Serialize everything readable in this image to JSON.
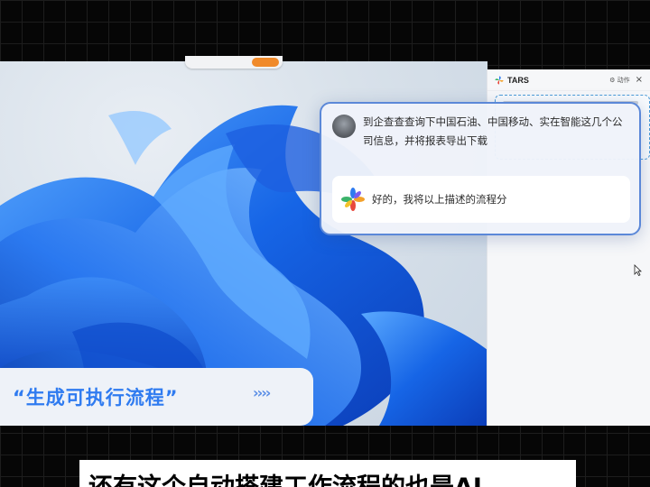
{
  "tars_panel": {
    "title": "TARS",
    "action_label": "动作",
    "close_label": "×"
  },
  "chat": {
    "user_message": "到企查查查询下中国石油、中国移动、实在智能这几个公司信息，并将报表导出下载",
    "bot_message": "好的，我将以上描述的流程分"
  },
  "caption": {
    "text": "“生成可执行流程”",
    "arrows": "››››"
  },
  "subtitle": {
    "text": "还有这个自动搭建工作流程的也是AI"
  },
  "colors": {
    "accent_blue": "#2f7bf0",
    "popup_border": "#5b88d8",
    "taskbar_accent": "#f08a2a"
  },
  "icons": {
    "tars_logo": "pinwheel-logo-icon",
    "cursor": "mouse-cursor-icon",
    "user": "user-avatar-icon"
  }
}
